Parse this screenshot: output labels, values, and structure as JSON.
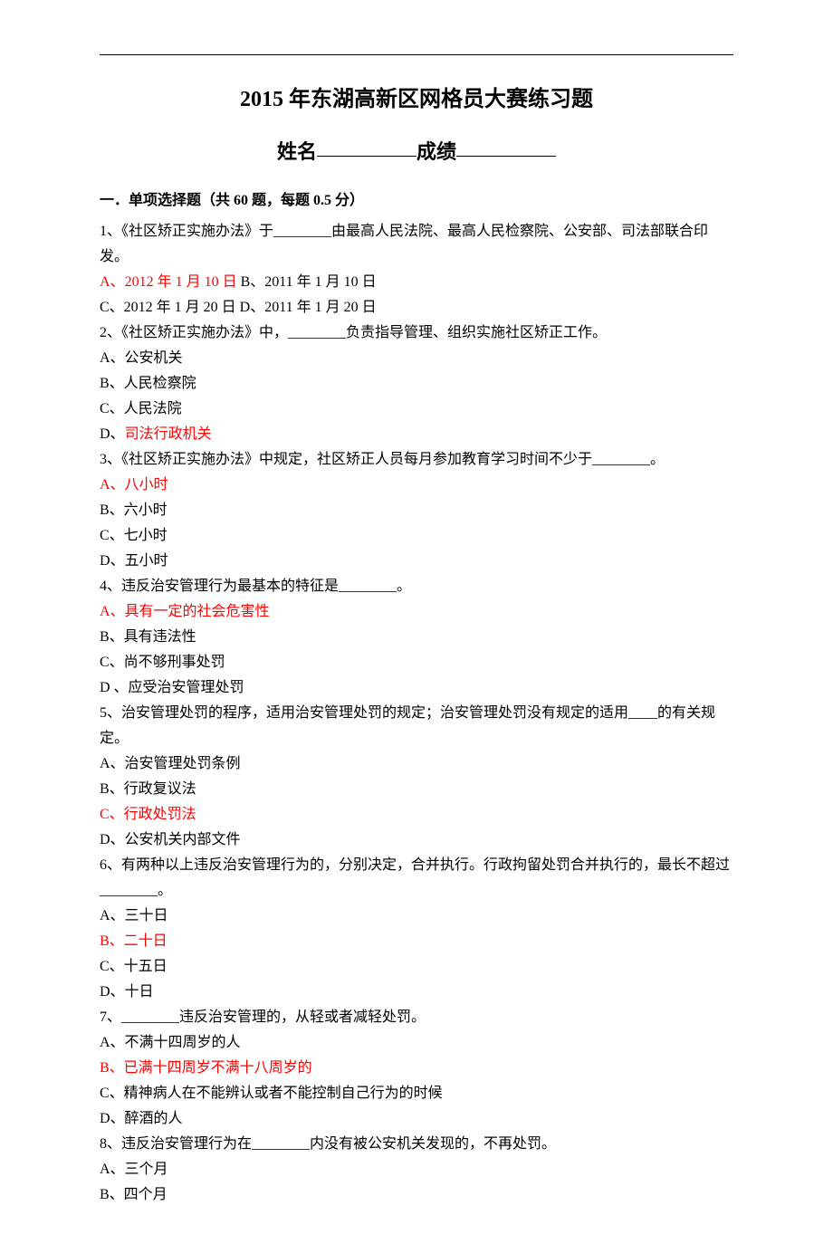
{
  "title": "2015 年东湖高新区网格员大赛练习题",
  "subtitle": {
    "name_label": "姓名",
    "score_label": "成绩"
  },
  "section1": {
    "header": "一．单项选择题（共 60 题，每题 0.5 分）"
  },
  "q1": {
    "text": "1、《社区矫正实施办法》于________由最高人民法院、最高人民检察院、公安部、司法部联合印发。",
    "a_prefix": "A、",
    "a_text": "2012 年 1 月 10 日",
    "b_text": " B、2011 年 1 月 10 日",
    "cd": "C、2012 年 1 月 20 日 D、2011 年 1 月 20 日"
  },
  "q2": {
    "text": "2、《社区矫正实施办法》中，________负责指导管理、组织实施社区矫正工作。",
    "a": "A、公安机关",
    "b": "B、人民检察院",
    "c": "C、人民法院",
    "d_prefix": "D、",
    "d_text": "司法行政机关"
  },
  "q3": {
    "text": "3、《社区矫正实施办法》中规定，社区矫正人员每月参加教育学习时间不少于________。",
    "a": "A、八小时",
    "b": "B、六小时",
    "c": "C、七小时",
    "d": "D、五小时"
  },
  "q4": {
    "text": "4、违反治安管理行为最基本的特征是________。",
    "a": "A、具有一定的社会危害性",
    "b": "B、具有违法性",
    "c": "C、尚不够刑事处罚",
    "d": "D 、应受治安管理处罚"
  },
  "q5": {
    "text": "5、治安管理处罚的程序，适用治安管理处罚的规定；治安管理处罚没有规定的适用____的有关规定。",
    "a": "A、治安管理处罚条例",
    "b": "B、行政复议法",
    "c": "C、行政处罚法",
    "d": "D、公安机关内部文件"
  },
  "q6": {
    "text": "6、有两种以上违反治安管理行为的，分别决定，合并执行。行政拘留处罚合并执行的，最长不超过________。",
    "a": "A、三十日",
    "b": "B、二十日",
    "c": "C、十五日",
    "d": "D、十日"
  },
  "q7": {
    "text": "7、________违反治安管理的，从轻或者减轻处罚。",
    "a": "A、不满十四周岁的人",
    "b": "B、已满十四周岁不满十八周岁的",
    "c": "C、精神病人在不能辨认或者不能控制自己行为的时候",
    "d": "D、醉酒的人"
  },
  "q8": {
    "text": "8、违反治安管理行为在________内没有被公安机关发现的，不再处罚。",
    "a": "A、三个月",
    "b": "B、四个月"
  }
}
